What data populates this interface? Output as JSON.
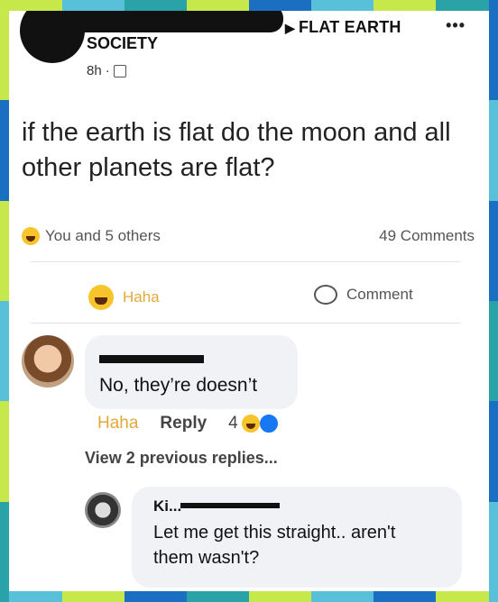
{
  "post": {
    "group_name": "FLAT EARTH",
    "group_name_cont": "SOCIETY",
    "more_icon": "•••",
    "time": "8h",
    "privacy_icon": "group-icon",
    "question": "if the earth is flat do the moon and all other planets are flat?"
  },
  "stats": {
    "reactions": "You and 5 others",
    "comments": "49 Comments"
  },
  "actions": {
    "haha": "Haha",
    "comment": "Comment"
  },
  "comment": {
    "text": "No, they’re doesn’t",
    "haha_label": "Haha",
    "reply_label": "Reply",
    "reaction_count": "4"
  },
  "view_replies": "View 2 previous replies...",
  "reply": {
    "author": "Ki...",
    "text_line1": "Let me get this straight.. aren't",
    "text_line2": "them wasn't?"
  },
  "colors": {
    "haha": "#e3a93b",
    "link_blue": "#1877f2",
    "frame": [
      "#c6e84a",
      "#1b6fc2",
      "#2aa3a8",
      "#58c0d8"
    ]
  }
}
